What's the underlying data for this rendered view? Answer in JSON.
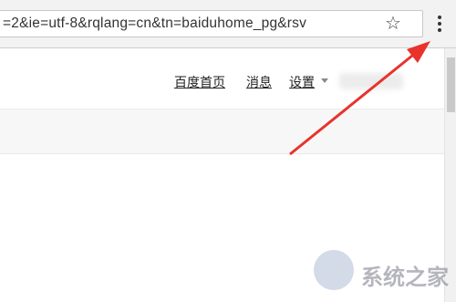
{
  "toolbar": {
    "url": "=2&ie=utf-8&rqlang=cn&tn=baiduhome_pg&rsv",
    "bookmark_icon": "star-icon",
    "menu_icon": "three-dot-menu-icon"
  },
  "nav": {
    "home": "百度首页",
    "messages": "消息",
    "settings": "设置"
  },
  "watermark": {
    "text": "系统之家"
  },
  "colors": {
    "arrow": "#e8332c"
  }
}
